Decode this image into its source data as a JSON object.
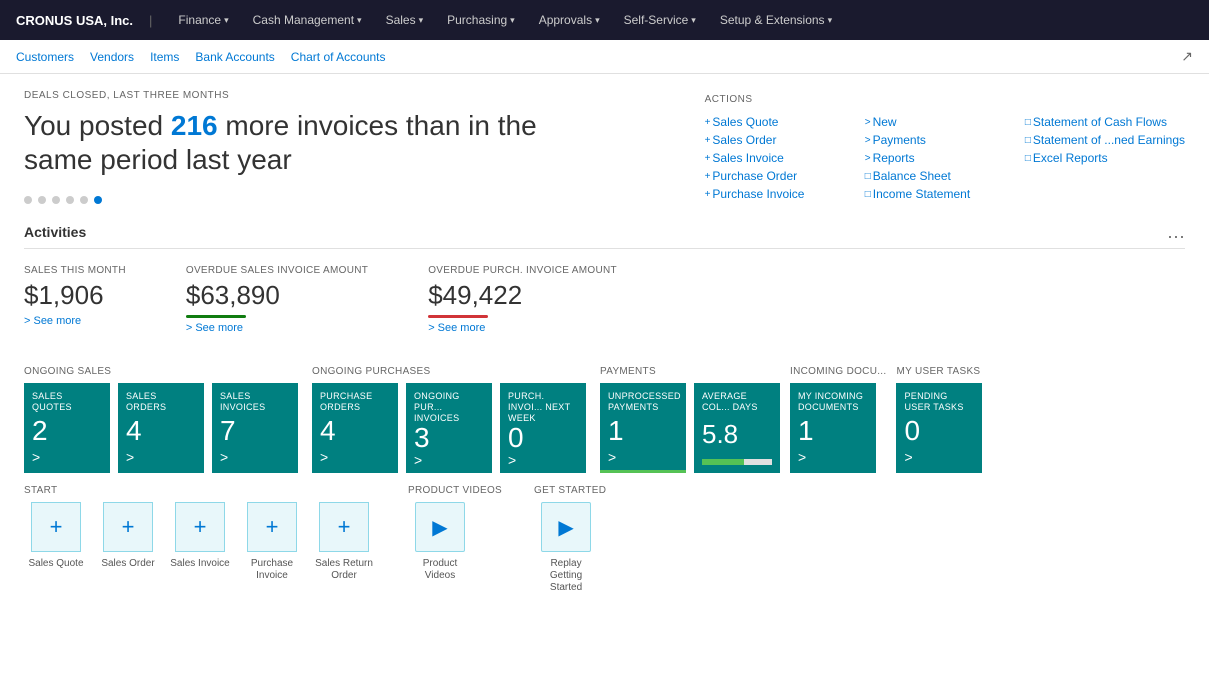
{
  "topNav": {
    "company": "CRONUS USA, Inc.",
    "items": [
      {
        "label": "Finance",
        "hasChevron": true
      },
      {
        "label": "Cash Management",
        "hasChevron": true
      },
      {
        "label": "Sales",
        "hasChevron": true
      },
      {
        "label": "Purchasing",
        "hasChevron": true
      },
      {
        "label": "Approvals",
        "hasChevron": true
      },
      {
        "label": "Self-Service",
        "hasChevron": true
      },
      {
        "label": "Setup & Extensions",
        "hasChevron": true
      }
    ]
  },
  "subNav": {
    "items": [
      "Customers",
      "Vendors",
      "Items",
      "Bank Accounts",
      "Chart of Accounts"
    ]
  },
  "hero": {
    "label": "DEALS CLOSED, LAST THREE MONTHS",
    "preText": "You posted ",
    "highlight": "216",
    "postText": " more invoices than in the same period last year",
    "dots": 6,
    "activeDot": 5
  },
  "actions": {
    "title": "ACTIONS",
    "col1": [
      {
        "prefix": "+",
        "label": "Sales Quote"
      },
      {
        "prefix": "+",
        "label": "Sales Order"
      },
      {
        "prefix": "+",
        "label": "Sales Invoice"
      },
      {
        "prefix": "+",
        "label": "Purchase Order"
      },
      {
        "prefix": "+",
        "label": "Purchase Invoice"
      }
    ],
    "col2": [
      {
        "prefix": ">",
        "label": "New"
      },
      {
        "prefix": ">",
        "label": "Payments"
      },
      {
        "prefix": ">",
        "label": "Reports"
      },
      {
        "prefix": "□",
        "label": "Balance Sheet"
      },
      {
        "prefix": "□",
        "label": "Income Statement"
      }
    ],
    "col3": [
      {
        "prefix": "□",
        "label": "Statement of Cash Flows"
      },
      {
        "prefix": "□",
        "label": "Statement of ...ned Earnings"
      },
      {
        "prefix": "□",
        "label": "Excel Reports"
      }
    ]
  },
  "activities": {
    "title": "Activities",
    "metrics": [
      {
        "label": "SALES THIS MONTH",
        "value": "$1,906",
        "bar": "none",
        "link": "> See more"
      },
      {
        "label": "OVERDUE SALES INVOICE AMOUNT",
        "value": "$63,890",
        "bar": "green",
        "link": "> See more"
      },
      {
        "label": "OVERDUE PURCH. INVOICE AMOUNT",
        "value": "$49,422",
        "bar": "red",
        "link": "> See more"
      }
    ]
  },
  "tiles": {
    "ongoingSales": {
      "label": "ONGOING SALES",
      "items": [
        {
          "label": "SALES QUOTES",
          "value": "2"
        },
        {
          "label": "SALES ORDERS",
          "value": "4"
        },
        {
          "label": "SALES INVOICES",
          "value": "7"
        }
      ]
    },
    "ongoingPurchases": {
      "label": "ONGOING PURCHASES",
      "items": [
        {
          "label": "PURCHASE ORDERS",
          "value": "4"
        },
        {
          "label": "ONGOING PUR... INVOICES",
          "value": "3"
        },
        {
          "label": "PURCH. INVOI... NEXT WEEK",
          "value": "0"
        }
      ]
    },
    "payments": {
      "label": "PAYMENTS",
      "items": [
        {
          "label": "UNPROCESSED PAYMENTS",
          "value": "1",
          "barColor": "green"
        },
        {
          "label": "AVERAGE COL... DAYS",
          "value": "5.8",
          "barColor": "mixed"
        }
      ]
    },
    "incomingDocs": {
      "label": "INCOMING DOCU...",
      "items": [
        {
          "label": "MY INCOMING DOCUMENTS",
          "value": "1"
        }
      ]
    },
    "userTasks": {
      "label": "MY USER TASKS",
      "items": [
        {
          "label": "PENDING USER TASKS",
          "value": "0"
        }
      ]
    }
  },
  "start": {
    "label": "START",
    "items": [
      {
        "label": "Sales Quote"
      },
      {
        "label": "Sales Order"
      },
      {
        "label": "Sales Invoice"
      },
      {
        "label": "Purchase Invoice"
      },
      {
        "label": "Sales Return Order"
      }
    ]
  },
  "productVideos": {
    "label": "PRODUCT VIDEOS",
    "items": [
      {
        "label": "Product Videos"
      }
    ]
  },
  "getStarted": {
    "label": "GET STARTED",
    "items": [
      {
        "label": "Replay Getting Started"
      }
    ]
  }
}
